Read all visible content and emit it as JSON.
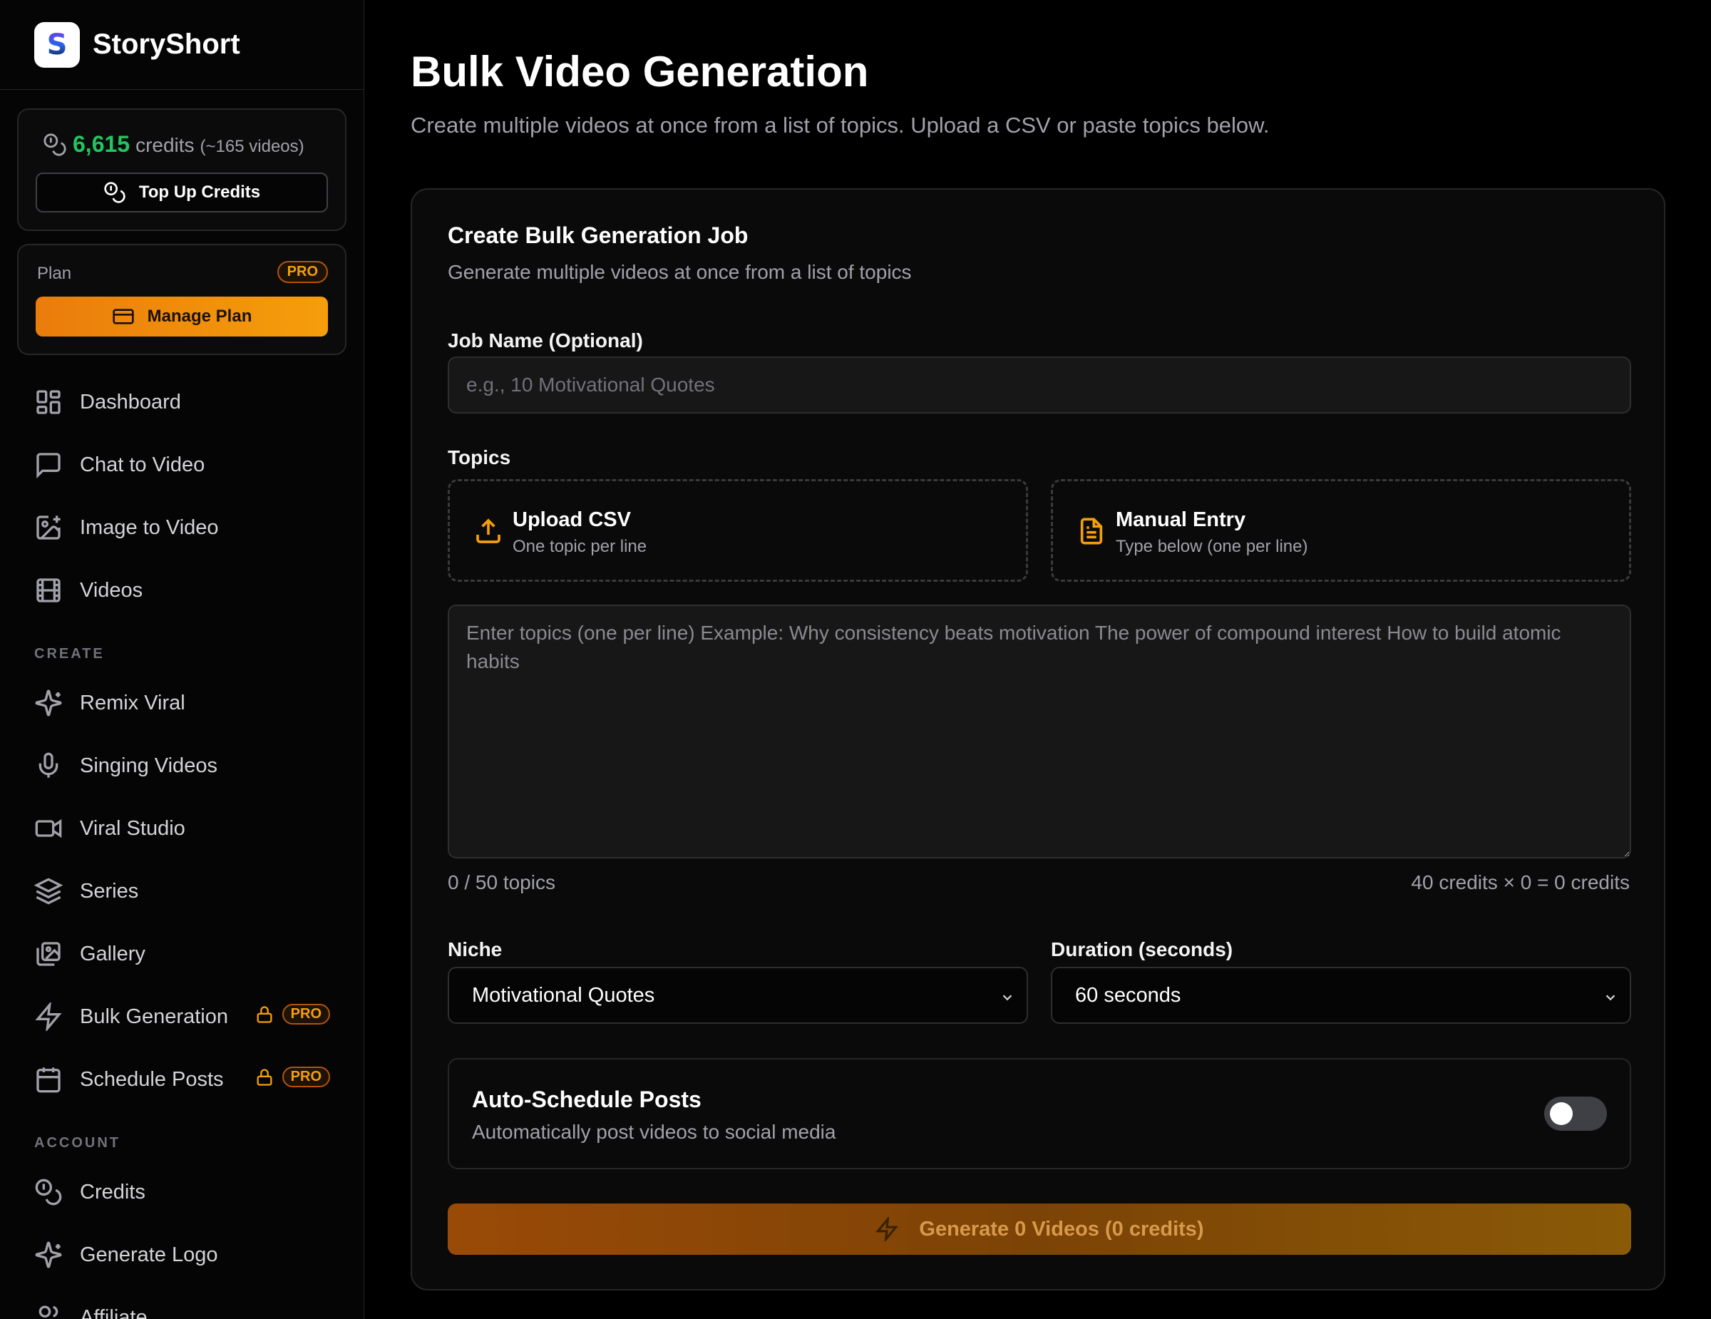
{
  "brand": {
    "logo_letter": "S",
    "name": "StoryShort"
  },
  "credits": {
    "amount": "6,615",
    "word": "credits",
    "videos": "(~165 videos)",
    "topup_label": "Top Up Credits",
    "amount_color": "#22c55e"
  },
  "plan": {
    "label": "Plan",
    "badge": "PRO",
    "manage_label": "Manage Plan"
  },
  "nav": {
    "main": [
      {
        "label": "Dashboard",
        "icon": "grid-icon"
      },
      {
        "label": "Chat to Video",
        "icon": "chat-icon"
      },
      {
        "label": "Image to Video",
        "icon": "image-plus-icon"
      },
      {
        "label": "Videos",
        "icon": "film-icon"
      }
    ],
    "create_label": "CREATE",
    "create": [
      {
        "label": "Remix Viral",
        "icon": "sparkles-icon"
      },
      {
        "label": "Singing Videos",
        "icon": "microphone-icon"
      },
      {
        "label": "Viral Studio",
        "icon": "video-camera-icon"
      },
      {
        "label": "Series",
        "icon": "layers-icon"
      },
      {
        "label": "Gallery",
        "icon": "images-icon"
      },
      {
        "label": "Bulk Generation",
        "icon": "lightning-icon",
        "badge": "PRO"
      },
      {
        "label": "Schedule Posts",
        "icon": "calendar-icon",
        "badge": "PRO"
      }
    ],
    "account_label": "ACCOUNT",
    "account": [
      {
        "label": "Credits",
        "icon": "coins-icon"
      },
      {
        "label": "Generate Logo",
        "icon": "sparkles-icon"
      },
      {
        "label": "Affiliate",
        "icon": "users-icon"
      }
    ]
  },
  "page": {
    "title": "Bulk Video Generation",
    "subtitle": "Create multiple videos at once from a list of topics. Upload a CSV or paste topics below."
  },
  "form": {
    "title": "Create Bulk Generation Job",
    "subtitle": "Generate multiple videos at once from a list of topics",
    "job_name_label": "Job Name (Optional)",
    "job_name_placeholder": "e.g., 10 Motivational Quotes",
    "job_name_value": "",
    "topics_label": "Topics",
    "upload_title": "Upload CSV",
    "upload_sub": "One topic per line",
    "manual_title": "Manual Entry",
    "manual_sub": "Type below (one per line)",
    "topics_placeholder": "Enter topics (one per line) Example: Why consistency beats motivation The power of compound interest How to build atomic habits",
    "topics_value": "",
    "topic_count": "0 / 50 topics",
    "credit_calc": "40 credits × 0 = 0 credits",
    "niche_label": "Niche",
    "niche_value": "Motivational Quotes",
    "duration_label": "Duration (seconds)",
    "duration_value": "60 seconds",
    "auto_title": "Auto-Schedule Posts",
    "auto_sub": "Automatically post videos to social media",
    "auto_enabled": false,
    "generate_label": "Generate 0 Videos (0 credits)",
    "accent_color": "#f59e0b"
  }
}
